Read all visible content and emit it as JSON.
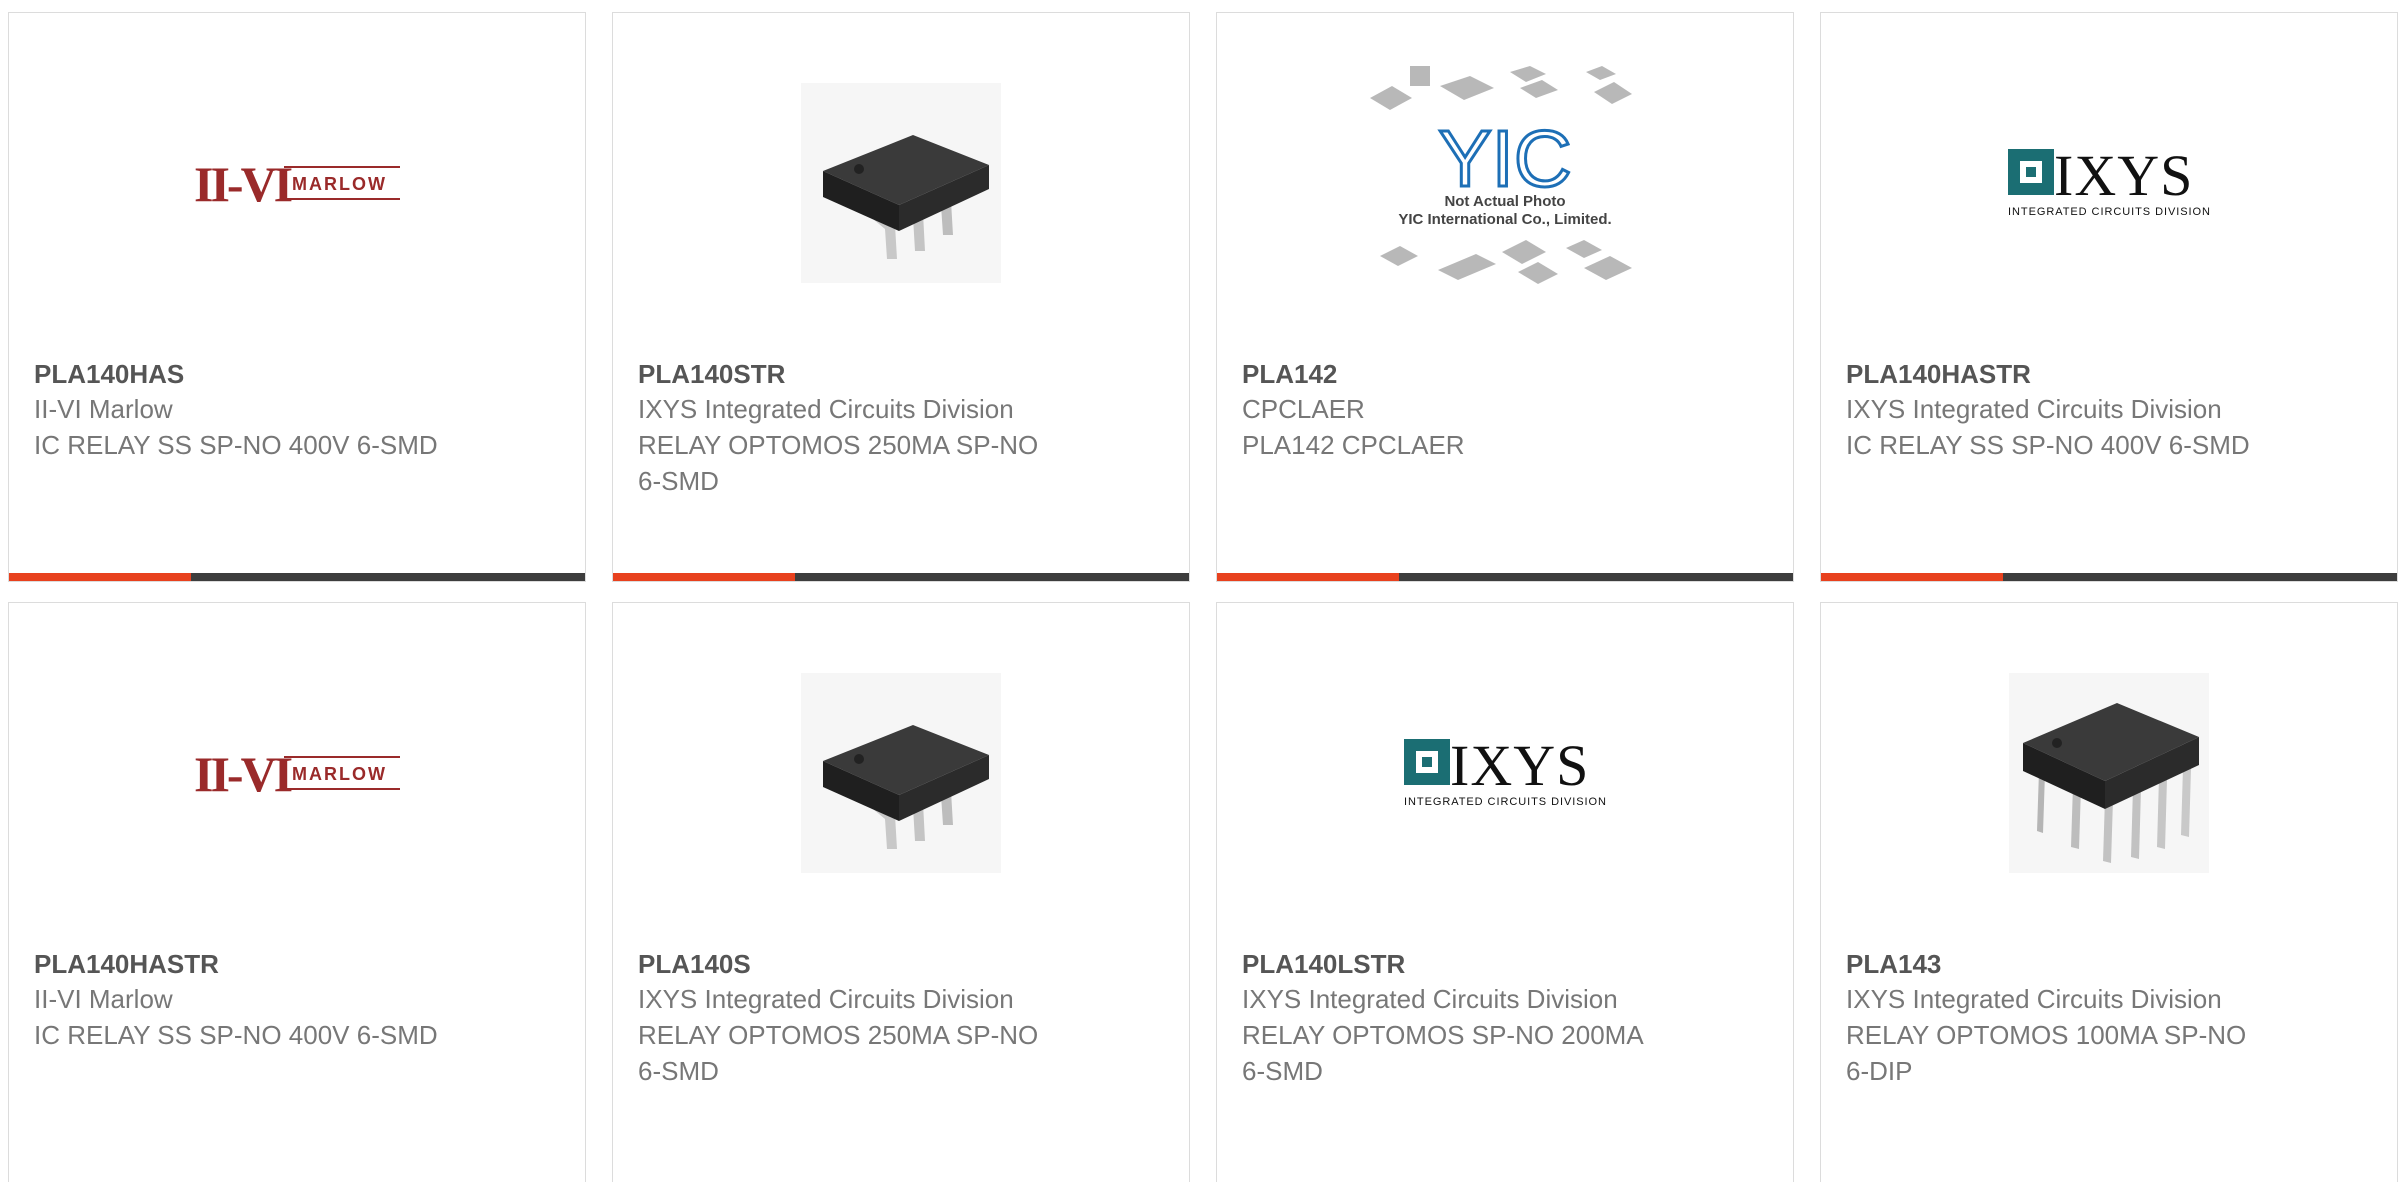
{
  "colors": {
    "accent": "#e8411e",
    "bar": "#3d3d3d",
    "border": "#dcdcdc"
  },
  "products": [
    {
      "part": "PLA140HAS",
      "manufacturer": "II-VI Marlow",
      "description": "IC RELAY SS SP-NO 400V 6-SMD",
      "image": "marlow-logo"
    },
    {
      "part": "PLA140STR",
      "manufacturer": "IXYS Integrated Circuits Division",
      "description": "RELAY OPTOMOS 250MA SP-NO 6-SMD",
      "image": "chip-smd-photo"
    },
    {
      "part": "PLA142",
      "manufacturer": "CPCLAER",
      "description": "PLA142 CPCLAER",
      "image": "yic-placeholder",
      "placeholder_text": [
        "Not Actual Photo",
        "YIC International Co., Limited."
      ]
    },
    {
      "part": "PLA140HASTR",
      "manufacturer": "IXYS Integrated Circuits Division",
      "description": "IC RELAY SS SP-NO 400V 6-SMD",
      "image": "ixys-logo"
    },
    {
      "part": "PLA140HASTR",
      "manufacturer": "II-VI Marlow",
      "description": "IC RELAY SS SP-NO 400V 6-SMD",
      "image": "marlow-logo"
    },
    {
      "part": "PLA140S",
      "manufacturer": "IXYS Integrated Circuits Division",
      "description": "RELAY OPTOMOS 250MA SP-NO 6-SMD",
      "image": "chip-smd-photo"
    },
    {
      "part": "PLA140LSTR",
      "manufacturer": "IXYS Integrated Circuits Division",
      "description": "RELAY OPTOMOS SP-NO 200MA 6-SMD",
      "image": "ixys-logo"
    },
    {
      "part": "PLA143",
      "manufacturer": "IXYS Integrated Circuits Division",
      "description": "RELAY OPTOMOS 100MA SP-NO 6-DIP",
      "image": "chip-dip-photo"
    }
  ],
  "logos": {
    "marlow": {
      "mark": "II-VI",
      "word": "MARLOW"
    },
    "ixys": {
      "word": "IXYS",
      "tagline": "INTEGRATED CIRCUITS DIVISION"
    },
    "yic": {
      "mark": "YIC"
    }
  }
}
